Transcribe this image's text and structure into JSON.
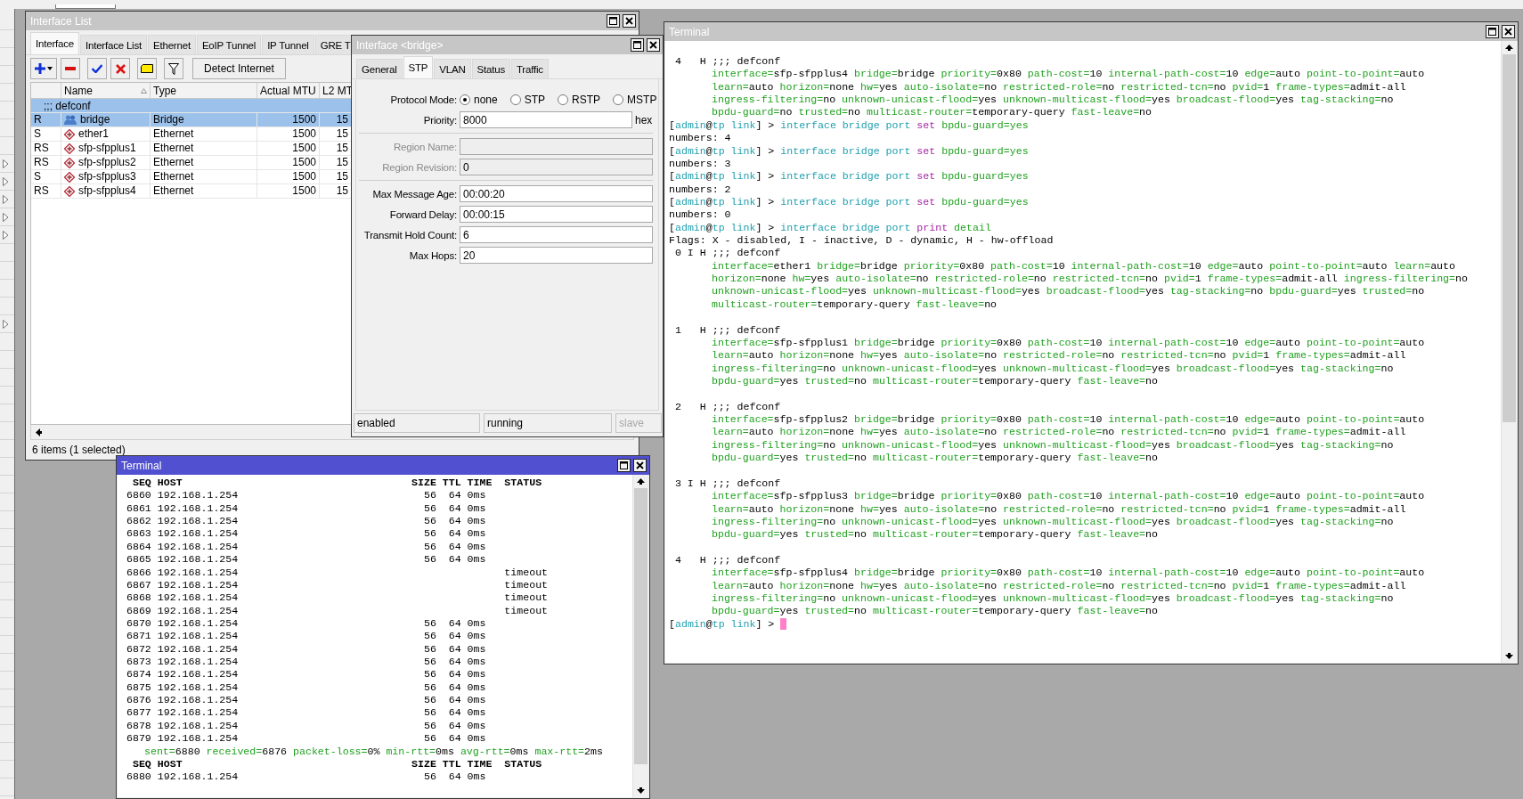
{
  "interface_list": {
    "title": "Interface List",
    "tabs": [
      {
        "label": "Interface",
        "selected": true
      },
      {
        "label": "Interface List",
        "selected": false
      },
      {
        "label": "Ethernet",
        "selected": false
      },
      {
        "label": "EoIP Tunnel",
        "selected": false
      },
      {
        "label": "IP Tunnel",
        "selected": false
      },
      {
        "label": "GRE T",
        "selected": false
      }
    ],
    "detect_button": "Detect Internet",
    "columns": [
      "Name",
      "Type",
      "Actual MTU",
      "L2 MT"
    ],
    "rows": [
      {
        "comment": ";;; defconf",
        "flags": "R",
        "name": "bridge",
        "type": "Bridge",
        "actual_mtu": "1500",
        "l2_mtu": "15",
        "kind": "bridge",
        "selected": true
      },
      {
        "flags": "S",
        "name": "ether1",
        "type": "Ethernet",
        "actual_mtu": "1500",
        "l2_mtu": "15",
        "kind": "ethernet",
        "selected": false
      },
      {
        "flags": "RS",
        "name": "sfp-sfpplus1",
        "type": "Ethernet",
        "actual_mtu": "1500",
        "l2_mtu": "15",
        "kind": "ethernet",
        "selected": false
      },
      {
        "flags": "RS",
        "name": "sfp-sfpplus2",
        "type": "Ethernet",
        "actual_mtu": "1500",
        "l2_mtu": "15",
        "kind": "ethernet",
        "selected": false
      },
      {
        "flags": "S",
        "name": "sfp-sfpplus3",
        "type": "Ethernet",
        "actual_mtu": "1500",
        "l2_mtu": "15",
        "kind": "ethernet",
        "selected": false
      },
      {
        "flags": "RS",
        "name": "sfp-sfpplus4",
        "type": "Ethernet",
        "actual_mtu": "1500",
        "l2_mtu": "15",
        "kind": "ethernet",
        "selected": false
      }
    ],
    "status": "6 items (1 selected)"
  },
  "bridge_dialog": {
    "title": "Interface <bridge>",
    "tabs": [
      {
        "label": "General",
        "selected": false
      },
      {
        "label": "STP",
        "selected": true
      },
      {
        "label": "VLAN",
        "selected": false
      },
      {
        "label": "Status",
        "selected": false
      },
      {
        "label": "Traffic",
        "selected": false
      }
    ],
    "groups": [
      [
        {
          "kind": "radio",
          "label": "Protocol Mode:",
          "options": [
            {
              "label": "none",
              "selected": true
            },
            {
              "label": "STP",
              "selected": false
            },
            {
              "label": "RSTP",
              "selected": false
            },
            {
              "label": "MSTP",
              "selected": false
            }
          ]
        },
        {
          "kind": "text",
          "label": "Priority:",
          "value": "8000",
          "unit": "hex",
          "disabled": false
        }
      ],
      [
        {
          "kind": "text",
          "label": "Region Name:",
          "disabled": true
        },
        {
          "kind": "text",
          "label": "Region Revision:",
          "value": "0",
          "disabled": true
        }
      ],
      [
        {
          "kind": "text",
          "label": "Max Message Age:",
          "value": "00:00:20",
          "disabled": false
        },
        {
          "kind": "text",
          "label": "Forward Delay:",
          "value": "00:00:15",
          "disabled": false
        },
        {
          "kind": "text",
          "label": "Transmit Hold Count:",
          "value": "6",
          "disabled": false
        },
        {
          "kind": "text",
          "label": "Max Hops:",
          "value": "20",
          "disabled": false
        }
      ]
    ],
    "status": [
      {
        "text": "enabled",
        "disabled": false
      },
      {
        "text": "running",
        "disabled": false
      },
      {
        "text": "slave",
        "disabled": true
      }
    ]
  },
  "ping_terminal": {
    "title": "Terminal",
    "lines": [
      {
        "kind": "header",
        "seq": "SEQ",
        "host": "HOST",
        "size": "SIZE",
        "ttl": "TTL",
        "time": "TIME",
        "status": "STATUS"
      },
      {
        "kind": "reply",
        "seq": "6860",
        "host": "192.168.1.254",
        "size": "56",
        "ttl": "64",
        "time": "0ms"
      },
      {
        "kind": "reply",
        "seq": "6861",
        "host": "192.168.1.254",
        "size": "56",
        "ttl": "64",
        "time": "0ms"
      },
      {
        "kind": "reply",
        "seq": "6862",
        "host": "192.168.1.254",
        "size": "56",
        "ttl": "64",
        "time": "0ms"
      },
      {
        "kind": "reply",
        "seq": "6863",
        "host": "192.168.1.254",
        "size": "56",
        "ttl": "64",
        "time": "0ms"
      },
      {
        "kind": "reply",
        "seq": "6864",
        "host": "192.168.1.254",
        "size": "56",
        "ttl": "64",
        "time": "0ms"
      },
      {
        "kind": "reply",
        "seq": "6865",
        "host": "192.168.1.254",
        "size": "56",
        "ttl": "64",
        "time": "0ms"
      },
      {
        "kind": "reply",
        "seq": "6866",
        "host": "192.168.1.254",
        "status": "timeout"
      },
      {
        "kind": "reply",
        "seq": "6867",
        "host": "192.168.1.254",
        "status": "timeout"
      },
      {
        "kind": "reply",
        "seq": "6868",
        "host": "192.168.1.254",
        "status": "timeout"
      },
      {
        "kind": "reply",
        "seq": "6869",
        "host": "192.168.1.254",
        "status": "timeout"
      },
      {
        "kind": "reply",
        "seq": "6870",
        "host": "192.168.1.254",
        "size": "56",
        "ttl": "64",
        "time": "0ms"
      },
      {
        "kind": "reply",
        "seq": "6871",
        "host": "192.168.1.254",
        "size": "56",
        "ttl": "64",
        "time": "0ms"
      },
      {
        "kind": "reply",
        "seq": "6872",
        "host": "192.168.1.254",
        "size": "56",
        "ttl": "64",
        "time": "0ms"
      },
      {
        "kind": "reply",
        "seq": "6873",
        "host": "192.168.1.254",
        "size": "56",
        "ttl": "64",
        "time": "0ms"
      },
      {
        "kind": "reply",
        "seq": "6874",
        "host": "192.168.1.254",
        "size": "56",
        "ttl": "64",
        "time": "0ms"
      },
      {
        "kind": "reply",
        "seq": "6875",
        "host": "192.168.1.254",
        "size": "56",
        "ttl": "64",
        "time": "0ms"
      },
      {
        "kind": "reply",
        "seq": "6876",
        "host": "192.168.1.254",
        "size": "56",
        "ttl": "64",
        "time": "0ms"
      },
      {
        "kind": "reply",
        "seq": "6877",
        "host": "192.168.1.254",
        "size": "56",
        "ttl": "64",
        "time": "0ms"
      },
      {
        "kind": "reply",
        "seq": "6878",
        "host": "192.168.1.254",
        "size": "56",
        "ttl": "64",
        "time": "0ms"
      },
      {
        "kind": "reply",
        "seq": "6879",
        "host": "192.168.1.254",
        "size": "56",
        "ttl": "64",
        "time": "0ms"
      },
      {
        "kind": "summary",
        "text": "sent=6880 received=6876 packet-loss=0% min-rtt=0ms avg-rtt=0ms max-rtt=2ms"
      },
      {
        "kind": "header",
        "seq": "SEQ",
        "host": "HOST",
        "size": "SIZE",
        "ttl": "TTL",
        "time": "TIME",
        "status": "STATUS"
      },
      {
        "kind": "reply",
        "seq": "6880",
        "host": "192.168.1.254",
        "size": "56",
        "ttl": "64",
        "time": "0ms"
      }
    ]
  },
  "main_terminal": {
    "title": "Terminal",
    "lines": [
      {
        "kind": "plain",
        "text": " 4   H ;;; defconf"
      },
      {
        "kind": "attrs",
        "text": "interface=sfp-sfpplus4 bridge=bridge priority=0x80 path-cost=10 internal-path-cost=10 edge=auto point-to-point=auto"
      },
      {
        "kind": "attrs",
        "text": "learn=auto horizon=none hw=yes auto-isolate=no restricted-role=no restricted-tcn=no pvid=1 frame-types=admit-all"
      },
      {
        "kind": "attrs",
        "text": "ingress-filtering=no unknown-unicast-flood=yes unknown-multicast-flood=yes broadcast-flood=yes tag-stacking=no"
      },
      {
        "kind": "attrs",
        "text": "bpdu-guard=no trusted=no multicast-router=temporary-query fast-leave=no"
      },
      {
        "kind": "prompt",
        "parts": [
          {
            "text": "["
          },
          {
            "text": "admin",
            "color": "#1f9fae"
          },
          {
            "text": "@"
          },
          {
            "text": "tp link",
            "color": "#1f9fae"
          },
          {
            "text": "] > "
          },
          {
            "text": "interface bridge port ",
            "color": "#1f9fae"
          },
          {
            "text": "set ",
            "color": "#a526a5"
          },
          {
            "text": "bpdu-guard=yes",
            "color": "#21a121"
          }
        ]
      },
      {
        "kind": "plain",
        "text": "numbers: 4"
      },
      {
        "kind": "prompt",
        "parts": [
          {
            "text": "["
          },
          {
            "text": "admin",
            "color": "#1f9fae"
          },
          {
            "text": "@"
          },
          {
            "text": "tp link",
            "color": "#1f9fae"
          },
          {
            "text": "] > "
          },
          {
            "text": "interface bridge port ",
            "color": "#1f9fae"
          },
          {
            "text": "set ",
            "color": "#a526a5"
          },
          {
            "text": "bpdu-guard=yes",
            "color": "#21a121"
          }
        ]
      },
      {
        "kind": "plain",
        "text": "numbers: 3"
      },
      {
        "kind": "prompt",
        "parts": [
          {
            "text": "["
          },
          {
            "text": "admin",
            "color": "#1f9fae"
          },
          {
            "text": "@"
          },
          {
            "text": "tp link",
            "color": "#1f9fae"
          },
          {
            "text": "] > "
          },
          {
            "text": "interface bridge port ",
            "color": "#1f9fae"
          },
          {
            "text": "set ",
            "color": "#a526a5"
          },
          {
            "text": "bpdu-guard=yes",
            "color": "#21a121"
          }
        ]
      },
      {
        "kind": "plain",
        "text": "numbers: 2"
      },
      {
        "kind": "prompt",
        "parts": [
          {
            "text": "["
          },
          {
            "text": "admin",
            "color": "#1f9fae"
          },
          {
            "text": "@"
          },
          {
            "text": "tp link",
            "color": "#1f9fae"
          },
          {
            "text": "] > "
          },
          {
            "text": "interface bridge port ",
            "color": "#1f9fae"
          },
          {
            "text": "set ",
            "color": "#a526a5"
          },
          {
            "text": "bpdu-guard=yes",
            "color": "#21a121"
          }
        ]
      },
      {
        "kind": "plain",
        "text": "numbers: 0"
      },
      {
        "kind": "prompt",
        "parts": [
          {
            "text": "["
          },
          {
            "text": "admin",
            "color": "#1f9fae"
          },
          {
            "text": "@"
          },
          {
            "text": "tp link",
            "color": "#1f9fae"
          },
          {
            "text": "] > "
          },
          {
            "text": "interface bridge port ",
            "color": "#1f9fae"
          },
          {
            "text": "print ",
            "color": "#a526a5"
          },
          {
            "text": "detail",
            "color": "#21a121"
          }
        ]
      },
      {
        "kind": "plain",
        "text": "Flags: X - disabled, I - inactive, D - dynamic, H - hw-offload"
      },
      {
        "kind": "plain",
        "text": " 0 I H ;;; defconf"
      },
      {
        "kind": "attrs",
        "text": "interface=ether1 bridge=bridge priority=0x80 path-cost=10 internal-path-cost=10 edge=auto point-to-point=auto learn=auto"
      },
      {
        "kind": "attrs",
        "text": "horizon=none hw=yes auto-isolate=no restricted-role=no restricted-tcn=no pvid=1 frame-types=admit-all ingress-filtering=no"
      },
      {
        "kind": "attrs",
        "text": "unknown-unicast-flood=yes unknown-multicast-flood=yes broadcast-flood=yes tag-stacking=no bpdu-guard=yes trusted=no"
      },
      {
        "kind": "attrs",
        "text": "multicast-router=temporary-query fast-leave=no"
      },
      {
        "kind": "blank"
      },
      {
        "kind": "plain",
        "text": " 1   H ;;; defconf"
      },
      {
        "kind": "attrs",
        "text": "interface=sfp-sfpplus1 bridge=bridge priority=0x80 path-cost=10 internal-path-cost=10 edge=auto point-to-point=auto"
      },
      {
        "kind": "attrs",
        "text": "learn=auto horizon=none hw=yes auto-isolate=no restricted-role=no restricted-tcn=no pvid=1 frame-types=admit-all"
      },
      {
        "kind": "attrs",
        "text": "ingress-filtering=no unknown-unicast-flood=yes unknown-multicast-flood=yes broadcast-flood=yes tag-stacking=no"
      },
      {
        "kind": "attrs",
        "text": "bpdu-guard=yes trusted=no multicast-router=temporary-query fast-leave=no"
      },
      {
        "kind": "blank"
      },
      {
        "kind": "plain",
        "text": " 2   H ;;; defconf"
      },
      {
        "kind": "attrs",
        "text": "interface=sfp-sfpplus2 bridge=bridge priority=0x80 path-cost=10 internal-path-cost=10 edge=auto point-to-point=auto"
      },
      {
        "kind": "attrs",
        "text": "learn=auto horizon=none hw=yes auto-isolate=no restricted-role=no restricted-tcn=no pvid=1 frame-types=admit-all"
      },
      {
        "kind": "attrs",
        "text": "ingress-filtering=no unknown-unicast-flood=yes unknown-multicast-flood=yes broadcast-flood=yes tag-stacking=no"
      },
      {
        "kind": "attrs",
        "text": "bpdu-guard=yes trusted=no multicast-router=temporary-query fast-leave=no"
      },
      {
        "kind": "blank"
      },
      {
        "kind": "plain",
        "text": " 3 I H ;;; defconf"
      },
      {
        "kind": "attrs",
        "text": "interface=sfp-sfpplus3 bridge=bridge priority=0x80 path-cost=10 internal-path-cost=10 edge=auto point-to-point=auto"
      },
      {
        "kind": "attrs",
        "text": "learn=auto horizon=none hw=yes auto-isolate=no restricted-role=no restricted-tcn=no pvid=1 frame-types=admit-all"
      },
      {
        "kind": "attrs",
        "text": "ingress-filtering=no unknown-unicast-flood=yes unknown-multicast-flood=yes broadcast-flood=yes tag-stacking=no"
      },
      {
        "kind": "attrs",
        "text": "bpdu-guard=yes trusted=no multicast-router=temporary-query fast-leave=no"
      },
      {
        "kind": "blank"
      },
      {
        "kind": "plain",
        "text": " 4   H ;;; defconf"
      },
      {
        "kind": "attrs",
        "text": "interface=sfp-sfpplus4 bridge=bridge priority=0x80 path-cost=10 internal-path-cost=10 edge=auto point-to-point=auto"
      },
      {
        "kind": "attrs",
        "text": "learn=auto horizon=none hw=yes auto-isolate=no restricted-role=no restricted-tcn=no pvid=1 frame-types=admit-all"
      },
      {
        "kind": "attrs",
        "text": "ingress-filtering=no unknown-unicast-flood=yes unknown-multicast-flood=yes broadcast-flood=yes tag-stacking=no"
      },
      {
        "kind": "attrs",
        "text": "bpdu-guard=yes trusted=no multicast-router=temporary-query fast-leave=no"
      },
      {
        "kind": "prompt",
        "cursor": true,
        "parts": [
          {
            "text": "["
          },
          {
            "text": "admin",
            "color": "#1f9fae"
          },
          {
            "text": "@"
          },
          {
            "text": "tp link",
            "color": "#1f9fae"
          },
          {
            "text": "] >"
          }
        ]
      }
    ]
  }
}
